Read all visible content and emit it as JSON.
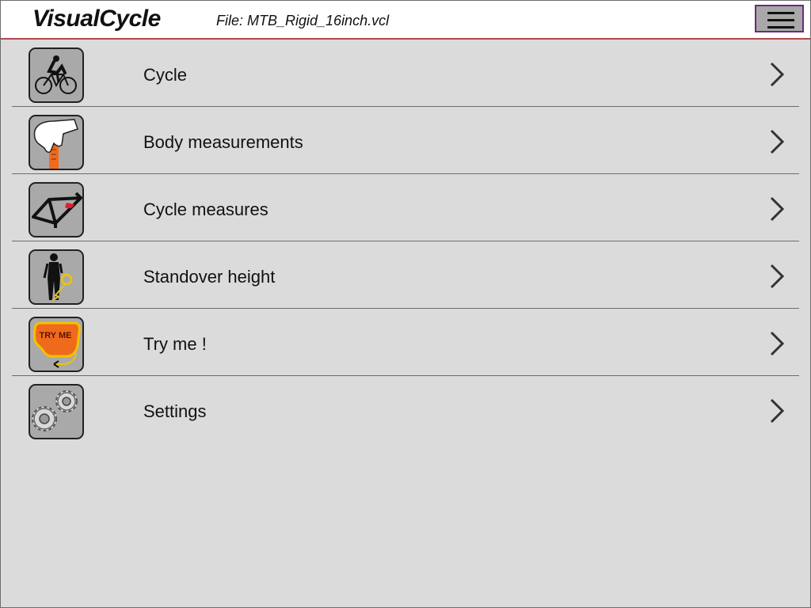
{
  "header": {
    "title": "VisualCycle",
    "file": "File: MTB_Rigid_16inch.vcl"
  },
  "menu": [
    {
      "label": "Cycle",
      "icon": "cyclist-icon"
    },
    {
      "label": "Body measurements",
      "icon": "hand-measuring-icon"
    },
    {
      "label": "Cycle measures",
      "icon": "bike-frame-icon"
    },
    {
      "label": "Standover height",
      "icon": "standover-person-icon"
    },
    {
      "label": "Try me !",
      "icon": "try-me-bubble-icon",
      "icon_text": "TRY ME"
    },
    {
      "label": "Settings",
      "icon": "gears-icon"
    }
  ],
  "colors": {
    "background": "#dcdbdc",
    "header_border": "#b5474a",
    "menu_button_border": "#6b2a7a",
    "accent_orange": "#f06a1c"
  }
}
